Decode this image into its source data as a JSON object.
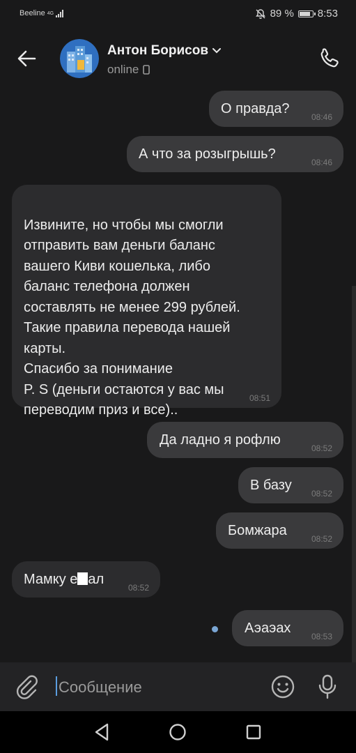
{
  "status_bar": {
    "carrier": "Beeline",
    "network": "4G",
    "battery": "89 %",
    "battery_level": 0.89,
    "time": "8:53"
  },
  "header": {
    "name": "Антон Борисов",
    "status": "online"
  },
  "messages": [
    {
      "text": "О правда?",
      "time": "08:46",
      "direction": "out"
    },
    {
      "text": "А что за розыгрышь?",
      "time": "08:46",
      "direction": "out"
    },
    {
      "text": "Извините, но чтобы мы смогли\nотправить вам деньги баланс\nвашего Киви кошелька, либо\nбаланс телефона должен\nсоставлять не менее 299 рублей.\nТакие правила перевода нашей\nкарты.\nСпасибо за понимание\nP. S (деньги остаются у вас мы\nпереводим приз и все)..",
      "time": "08:51",
      "direction": "in"
    },
    {
      "text": "Да ладно я рофлю",
      "time": "08:52",
      "direction": "out"
    },
    {
      "text": "В базу",
      "time": "08:52",
      "direction": "out"
    },
    {
      "text": "Бомжара",
      "time": "08:52",
      "direction": "out"
    },
    {
      "text": "Мамку е",
      "text_after": "ал",
      "time": "08:52",
      "direction": "in"
    },
    {
      "text": "Аэаэах",
      "time": "08:53",
      "direction": "out",
      "unread_dot": true
    }
  ],
  "composer": {
    "placeholder": "Сообщение"
  },
  "icons": {
    "back": "arrow-left-icon",
    "call": "phone-icon",
    "attach": "paperclip-icon",
    "emoji": "smiley-icon",
    "mic": "microphone-icon"
  },
  "colors": {
    "background": "#19191a",
    "bubble_out": "#3a3a3c",
    "bubble_in": "#2c2c2e",
    "caret": "#5b9ddf",
    "unread_dot": "#7aa6d4"
  }
}
